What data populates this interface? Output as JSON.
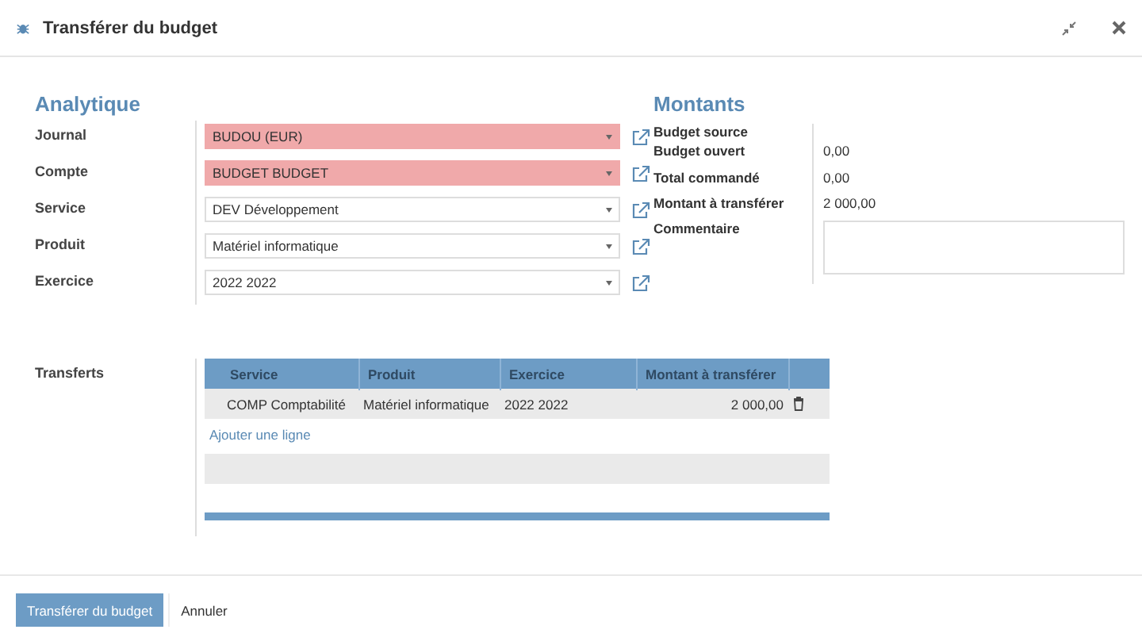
{
  "window": {
    "title": "Transférer du budget"
  },
  "analytique": {
    "heading": "Analytique",
    "fields": [
      {
        "label": "Journal",
        "value": "BUDOU (EUR)",
        "invalid": true
      },
      {
        "label": "Compte",
        "value": "BUDGET BUDGET",
        "invalid": true
      },
      {
        "label": "Service",
        "value": "DEV Développement",
        "invalid": false
      },
      {
        "label": "Produit",
        "value": "Matériel informatique",
        "invalid": false
      },
      {
        "label": "Exercice",
        "value": "2022 2022",
        "invalid": false
      }
    ]
  },
  "montants": {
    "heading": "Montants",
    "rows": [
      {
        "label": "Budget source"
      },
      {
        "label": "Budget ouvert",
        "value": "0,00"
      },
      {
        "label": "Total commandé",
        "value": "0,00"
      },
      {
        "label": "Montant à transférer",
        "value": "2 000,00"
      }
    ],
    "comment": {
      "label": "Commentaire"
    }
  },
  "transferts": {
    "label": "Transferts",
    "columns": [
      "Service",
      "Produit",
      "Exercice",
      "Montant à transférer"
    ],
    "rows": [
      [
        "COMP Comptabilité",
        "Matériel informatique",
        "2022 2022",
        "2 000,00"
      ]
    ],
    "add_link": "Ajouter une ligne"
  },
  "buttons": [
    {
      "label": "Transférer du budget",
      "kind": "primary"
    },
    {
      "label": "Annuler",
      "kind": "secondary"
    }
  ]
}
